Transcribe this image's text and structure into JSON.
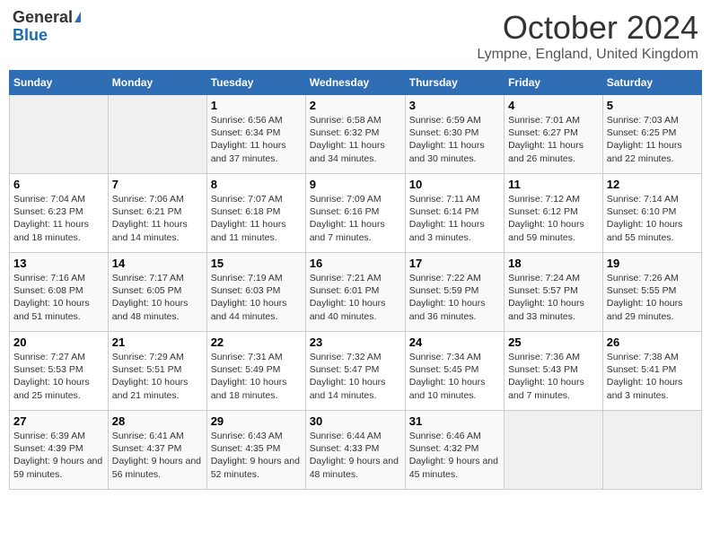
{
  "logo": {
    "line1": "General",
    "line2": "Blue"
  },
  "title": "October 2024",
  "location": "Lympne, England, United Kingdom",
  "days_of_week": [
    "Sunday",
    "Monday",
    "Tuesday",
    "Wednesday",
    "Thursday",
    "Friday",
    "Saturday"
  ],
  "weeks": [
    [
      {
        "day": "",
        "empty": true
      },
      {
        "day": "",
        "empty": true
      },
      {
        "day": "1",
        "sunrise": "Sunrise: 6:56 AM",
        "sunset": "Sunset: 6:34 PM",
        "daylight": "Daylight: 11 hours and 37 minutes."
      },
      {
        "day": "2",
        "sunrise": "Sunrise: 6:58 AM",
        "sunset": "Sunset: 6:32 PM",
        "daylight": "Daylight: 11 hours and 34 minutes."
      },
      {
        "day": "3",
        "sunrise": "Sunrise: 6:59 AM",
        "sunset": "Sunset: 6:30 PM",
        "daylight": "Daylight: 11 hours and 30 minutes."
      },
      {
        "day": "4",
        "sunrise": "Sunrise: 7:01 AM",
        "sunset": "Sunset: 6:27 PM",
        "daylight": "Daylight: 11 hours and 26 minutes."
      },
      {
        "day": "5",
        "sunrise": "Sunrise: 7:03 AM",
        "sunset": "Sunset: 6:25 PM",
        "daylight": "Daylight: 11 hours and 22 minutes."
      }
    ],
    [
      {
        "day": "6",
        "sunrise": "Sunrise: 7:04 AM",
        "sunset": "Sunset: 6:23 PM",
        "daylight": "Daylight: 11 hours and 18 minutes."
      },
      {
        "day": "7",
        "sunrise": "Sunrise: 7:06 AM",
        "sunset": "Sunset: 6:21 PM",
        "daylight": "Daylight: 11 hours and 14 minutes."
      },
      {
        "day": "8",
        "sunrise": "Sunrise: 7:07 AM",
        "sunset": "Sunset: 6:18 PM",
        "daylight": "Daylight: 11 hours and 11 minutes."
      },
      {
        "day": "9",
        "sunrise": "Sunrise: 7:09 AM",
        "sunset": "Sunset: 6:16 PM",
        "daylight": "Daylight: 11 hours and 7 minutes."
      },
      {
        "day": "10",
        "sunrise": "Sunrise: 7:11 AM",
        "sunset": "Sunset: 6:14 PM",
        "daylight": "Daylight: 11 hours and 3 minutes."
      },
      {
        "day": "11",
        "sunrise": "Sunrise: 7:12 AM",
        "sunset": "Sunset: 6:12 PM",
        "daylight": "Daylight: 10 hours and 59 minutes."
      },
      {
        "day": "12",
        "sunrise": "Sunrise: 7:14 AM",
        "sunset": "Sunset: 6:10 PM",
        "daylight": "Daylight: 10 hours and 55 minutes."
      }
    ],
    [
      {
        "day": "13",
        "sunrise": "Sunrise: 7:16 AM",
        "sunset": "Sunset: 6:08 PM",
        "daylight": "Daylight: 10 hours and 51 minutes."
      },
      {
        "day": "14",
        "sunrise": "Sunrise: 7:17 AM",
        "sunset": "Sunset: 6:05 PM",
        "daylight": "Daylight: 10 hours and 48 minutes."
      },
      {
        "day": "15",
        "sunrise": "Sunrise: 7:19 AM",
        "sunset": "Sunset: 6:03 PM",
        "daylight": "Daylight: 10 hours and 44 minutes."
      },
      {
        "day": "16",
        "sunrise": "Sunrise: 7:21 AM",
        "sunset": "Sunset: 6:01 PM",
        "daylight": "Daylight: 10 hours and 40 minutes."
      },
      {
        "day": "17",
        "sunrise": "Sunrise: 7:22 AM",
        "sunset": "Sunset: 5:59 PM",
        "daylight": "Daylight: 10 hours and 36 minutes."
      },
      {
        "day": "18",
        "sunrise": "Sunrise: 7:24 AM",
        "sunset": "Sunset: 5:57 PM",
        "daylight": "Daylight: 10 hours and 33 minutes."
      },
      {
        "day": "19",
        "sunrise": "Sunrise: 7:26 AM",
        "sunset": "Sunset: 5:55 PM",
        "daylight": "Daylight: 10 hours and 29 minutes."
      }
    ],
    [
      {
        "day": "20",
        "sunrise": "Sunrise: 7:27 AM",
        "sunset": "Sunset: 5:53 PM",
        "daylight": "Daylight: 10 hours and 25 minutes."
      },
      {
        "day": "21",
        "sunrise": "Sunrise: 7:29 AM",
        "sunset": "Sunset: 5:51 PM",
        "daylight": "Daylight: 10 hours and 21 minutes."
      },
      {
        "day": "22",
        "sunrise": "Sunrise: 7:31 AM",
        "sunset": "Sunset: 5:49 PM",
        "daylight": "Daylight: 10 hours and 18 minutes."
      },
      {
        "day": "23",
        "sunrise": "Sunrise: 7:32 AM",
        "sunset": "Sunset: 5:47 PM",
        "daylight": "Daylight: 10 hours and 14 minutes."
      },
      {
        "day": "24",
        "sunrise": "Sunrise: 7:34 AM",
        "sunset": "Sunset: 5:45 PM",
        "daylight": "Daylight: 10 hours and 10 minutes."
      },
      {
        "day": "25",
        "sunrise": "Sunrise: 7:36 AM",
        "sunset": "Sunset: 5:43 PM",
        "daylight": "Daylight: 10 hours and 7 minutes."
      },
      {
        "day": "26",
        "sunrise": "Sunrise: 7:38 AM",
        "sunset": "Sunset: 5:41 PM",
        "daylight": "Daylight: 10 hours and 3 minutes."
      }
    ],
    [
      {
        "day": "27",
        "sunrise": "Sunrise: 6:39 AM",
        "sunset": "Sunset: 4:39 PM",
        "daylight": "Daylight: 9 hours and 59 minutes."
      },
      {
        "day": "28",
        "sunrise": "Sunrise: 6:41 AM",
        "sunset": "Sunset: 4:37 PM",
        "daylight": "Daylight: 9 hours and 56 minutes."
      },
      {
        "day": "29",
        "sunrise": "Sunrise: 6:43 AM",
        "sunset": "Sunset: 4:35 PM",
        "daylight": "Daylight: 9 hours and 52 minutes."
      },
      {
        "day": "30",
        "sunrise": "Sunrise: 6:44 AM",
        "sunset": "Sunset: 4:33 PM",
        "daylight": "Daylight: 9 hours and 48 minutes."
      },
      {
        "day": "31",
        "sunrise": "Sunrise: 6:46 AM",
        "sunset": "Sunset: 4:32 PM",
        "daylight": "Daylight: 9 hours and 45 minutes."
      },
      {
        "day": "",
        "empty": true
      },
      {
        "day": "",
        "empty": true
      }
    ]
  ]
}
